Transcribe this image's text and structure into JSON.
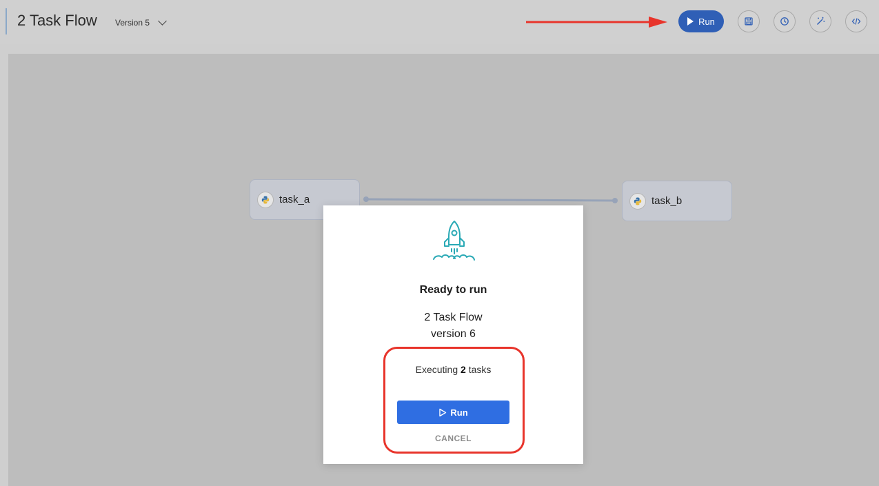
{
  "header": {
    "title": "2 Task Flow",
    "version": "Version 5",
    "run_label": "Run"
  },
  "toolbar": {
    "icons": [
      "save-icon",
      "history-icon",
      "magic-wand-icon",
      "code-icon"
    ]
  },
  "nodes": [
    {
      "label": "task_a"
    },
    {
      "label": "task_b"
    }
  ],
  "modal": {
    "title": "Ready to run",
    "flow_name": "2 Task Flow",
    "version": "version 6",
    "exec_prefix": "Executing",
    "task_count": "2",
    "exec_suffix": "tasks",
    "run_label": "Run",
    "cancel_label": "CANCEL"
  },
  "colors": {
    "primary": "#2f6ee2",
    "header_run": "#2f5fb6",
    "annotation": "#e8342b",
    "rocket": "#29a9b5"
  }
}
